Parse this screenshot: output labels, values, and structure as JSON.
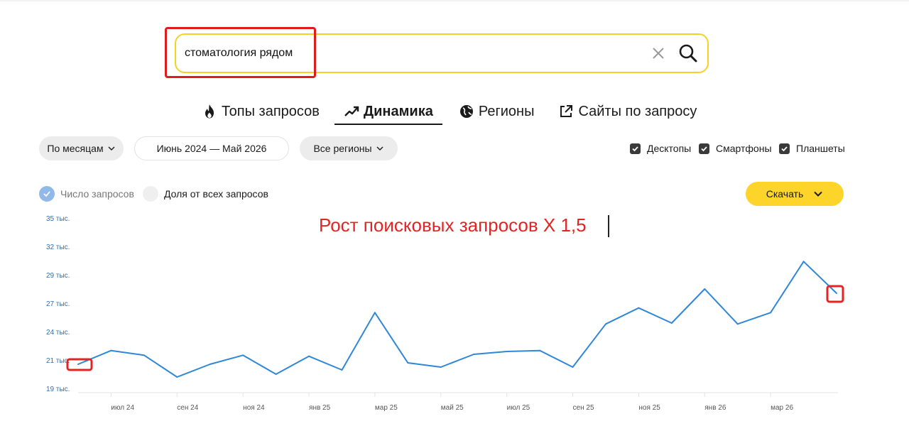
{
  "search": {
    "query": "стоматология рядом"
  },
  "tabs": [
    {
      "label": "Топы запросов",
      "icon": "fire-icon"
    },
    {
      "label": "Динамика",
      "icon": "trend-icon"
    },
    {
      "label": "Регионы",
      "icon": "globe-icon"
    },
    {
      "label": "Сайты по запросу",
      "icon": "external-link-icon"
    }
  ],
  "filters": {
    "period": "По месяцам",
    "date_range": "Июнь 2024 — Май 2026",
    "region": "Все регионы"
  },
  "devices": [
    {
      "label": "Десктопы",
      "checked": true
    },
    {
      "label": "Смартфоны",
      "checked": true
    },
    {
      "label": "Планшеты",
      "checked": true
    }
  ],
  "metrics": [
    {
      "label": "Число запросов",
      "selected": true
    },
    {
      "label": "Доля от всех запросов",
      "selected": false
    }
  ],
  "download_label": "Скачать",
  "annotation": "Рост поисковых запросов Х 1,5",
  "colors": {
    "accent": "#fdd42a",
    "line": "#2f87d8",
    "annotation": "#e32424"
  },
  "chart_data": {
    "type": "line",
    "y_tick_labels": [
      "19 тыс.",
      "21 тыс.",
      "24 тыс.",
      "27 тыс.",
      "29 тыс.",
      "32 тыс.",
      "35 тыс."
    ],
    "y_ticks": [
      19000,
      21000,
      24000,
      27000,
      29000,
      32000,
      35000
    ],
    "x_tick_labels": [
      "июл 24",
      "сен 24",
      "ноя 24",
      "янв 25",
      "мар 25",
      "май 25",
      "июл 25",
      "сен 25",
      "ноя 25",
      "янв 26",
      "мар 26"
    ],
    "x": [
      "июн 24",
      "июл 24",
      "авг 24",
      "сен 24",
      "окт 24",
      "ноя 24",
      "дек 24",
      "янв 25",
      "фев 25",
      "мар 25",
      "апр 25",
      "май 25",
      "июн 25",
      "июл 25",
      "авг 25",
      "сен 25",
      "окт 25",
      "ноя 25",
      "дек 25",
      "янв 26",
      "фев 26",
      "мар 26",
      "апр 26",
      "май 26"
    ],
    "values": [
      20700,
      22000,
      21500,
      19800,
      20700,
      21500,
      20000,
      21400,
      20300,
      26000,
      20800,
      20500,
      21600,
      21900,
      22000,
      20500,
      24800,
      26500,
      24900,
      28000,
      24800,
      26000,
      30400,
      27700
    ],
    "grid": false
  }
}
